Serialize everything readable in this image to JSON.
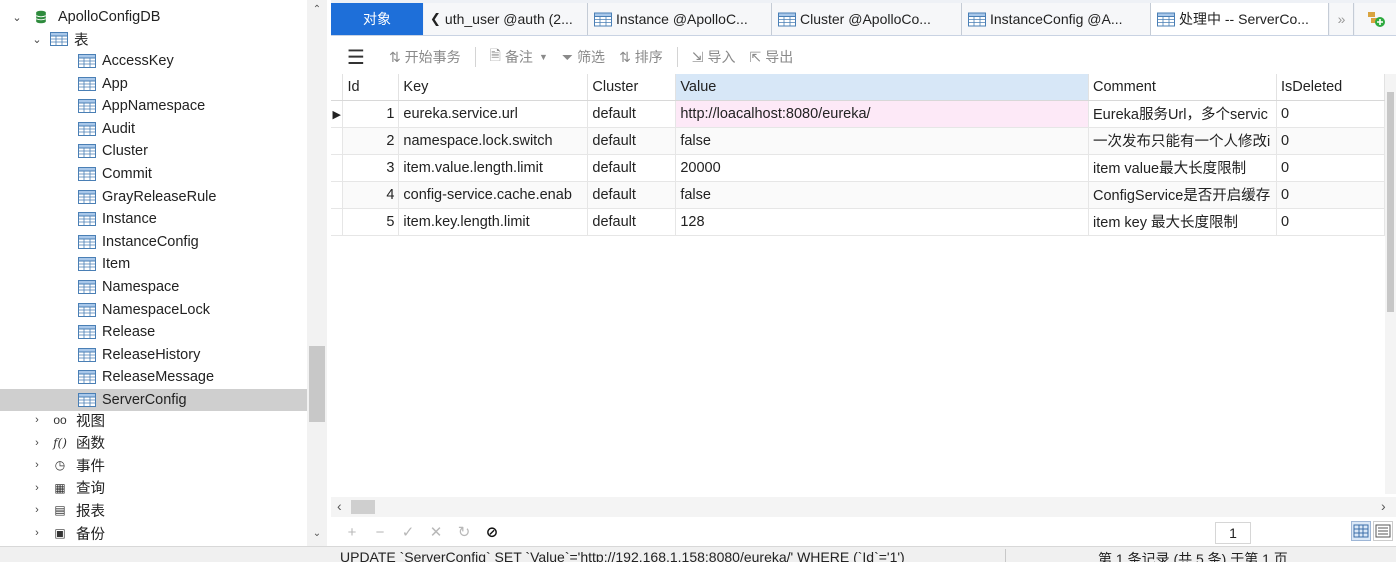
{
  "tree": {
    "db_name": "ApolloConfigDB",
    "tables_group": "表",
    "tables": [
      "AccessKey",
      "App",
      "AppNamespace",
      "Audit",
      "Cluster",
      "Commit",
      "GrayReleaseRule",
      "Instance",
      "InstanceConfig",
      "Item",
      "Namespace",
      "NamespaceLock",
      "Release",
      "ReleaseHistory",
      "ReleaseMessage",
      "ServerConfig"
    ],
    "selected_table": "ServerConfig",
    "groups": [
      {
        "label": "视图",
        "icon": "view-glasses-icon"
      },
      {
        "label": "函数",
        "icon": "function-icon"
      },
      {
        "label": "事件",
        "icon": "event-clock-icon"
      },
      {
        "label": "查询",
        "icon": "query-icon"
      },
      {
        "label": "报表",
        "icon": "report-icon"
      },
      {
        "label": "备份",
        "icon": "backup-icon"
      }
    ]
  },
  "tabs": {
    "objects": "对象",
    "items": [
      {
        "label": "uth_user @auth (2..."
      },
      {
        "label": "Instance @ApolloC..."
      },
      {
        "label": "Cluster @ApolloCo..."
      },
      {
        "label": "InstanceConfig @A..."
      },
      {
        "label": "处理中 -- ServerCo..."
      }
    ]
  },
  "toolbar": {
    "begin_tx": "开始事务",
    "note": "备注",
    "filter": "筛选",
    "sort": "排序",
    "import": "导入",
    "export": "导出"
  },
  "grid": {
    "columns": [
      "Id",
      "Key",
      "Cluster",
      "Value",
      "Comment",
      "IsDeleted"
    ],
    "rows": [
      [
        "1",
        "eureka.service.url",
        "default",
        "http://loacalhost:8080/eureka/",
        "Eureka服务Url，多个servic",
        "0"
      ],
      [
        "2",
        "namespace.lock.switch",
        "default",
        "false",
        "一次发布只能有一个人修改i",
        "0"
      ],
      [
        "3",
        "item.value.length.limit",
        "default",
        "20000",
        "item value最大长度限制",
        "0"
      ],
      [
        "4",
        "config-service.cache.enab",
        "default",
        "false",
        "ConfigService是否开启缓存",
        "0"
      ],
      [
        "5",
        "item.key.length.limit",
        "default",
        "128",
        "item key 最大长度限制",
        "0"
      ]
    ]
  },
  "navbar": {
    "page": "1"
  },
  "status": {
    "sql": "UPDATE `ServerConfig` SET `Value`='http://192.168.1.158:8080/eureka/' WHERE (`Id`='1')",
    "info": "第 1 条记录 (共 5 条) 于第 1 页"
  },
  "colors": {
    "accent": "#1e6fd9",
    "selection": "#cfcfcf",
    "header_highlight": "#d7e7f7",
    "value_highlight": "#fde9f7"
  }
}
